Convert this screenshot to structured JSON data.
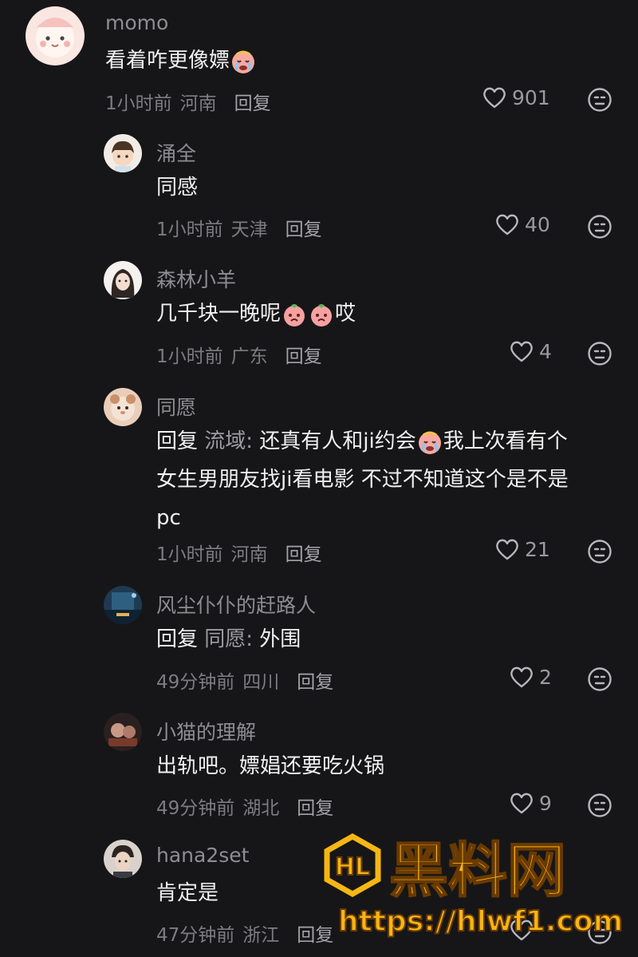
{
  "comments": [
    {
      "name": "momo",
      "text": "看着咋更像嫖",
      "time": "1小时前",
      "location": "河南",
      "reply": "回复",
      "likes": "901"
    },
    {
      "name": "涌全",
      "text": "同感",
      "time": "1小时前",
      "location": "天津",
      "reply": "回复",
      "likes": "40"
    },
    {
      "name": "森林小羊",
      "text_prefix": "几千块一晚呢",
      "text_suffix": "哎",
      "time": "1小时前",
      "location": "广东",
      "reply": "回复",
      "likes": "4"
    },
    {
      "name": "同愿",
      "reply_label": "回复",
      "mention": "流域:",
      "line1": " 还真有人和ji约会",
      "line1b": "我上次看有个",
      "line2": "女生男朋友找ji看电影 不过不知道这个是不是",
      "line3": "pc",
      "time": "1小时前",
      "location": "河南",
      "reply": "回复",
      "likes": "21"
    },
    {
      "name": "风尘仆仆的赶路人",
      "reply_label": "回复",
      "mention": "同愿:",
      "text": " 外围",
      "time": "49分钟前",
      "location": "四川",
      "reply": "回复",
      "likes": "2"
    },
    {
      "name": "小猫的理解",
      "text": "出轨吧。嫖娼还要吃火锅",
      "time": "49分钟前",
      "location": "湖北",
      "reply": "回复",
      "likes": "9"
    },
    {
      "name": "hana2set",
      "text": "肯定是",
      "time": "47分钟前",
      "location": "浙江",
      "reply": "回复",
      "likes": ""
    }
  ],
  "watermark": {
    "brand": "黑料网",
    "url": "https://hlwf1.com",
    "logo": "HL"
  },
  "icons": {
    "like": "heart-outline-icon",
    "dislike": "meh-face-icon"
  },
  "colors": {
    "background": "#161618",
    "name": "#8d8d92",
    "watermark": "#f6b613"
  }
}
